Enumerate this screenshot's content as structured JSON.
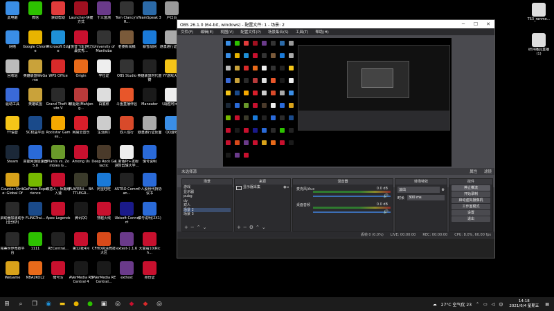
{
  "desktop_icons": [
    {
      "label": "此电脑",
      "color": "#3a8ee6"
    },
    {
      "label": "微信",
      "color": "#2dc100"
    },
    {
      "label": "获取帮助",
      "color": "#e23b3b"
    },
    {
      "label": "Launcher-快捷方式",
      "color": "#a01020"
    },
    {
      "label": "十三盒测",
      "color": "#6a3a8a"
    },
    {
      "label": "Tom Clancy's R...",
      "color": "#333"
    },
    {
      "label": "TeamSpeak 3",
      "color": "#2b6aa8"
    },
    {
      "label": "户口页",
      "color": "#999"
    },
    {
      "label": "网络",
      "color": "#3a8ee6"
    },
    {
      "label": "Google Chrome",
      "color": "#e8b400"
    },
    {
      "label": "Microsoft Edge",
      "color": "#1e90d8"
    },
    {
      "label": "[悦音飞车]努力最优秀...",
      "color": "#c8102e"
    },
    {
      "label": "University of Manitoba",
      "color": "#333"
    },
    {
      "label": "老婆新闻稿",
      "color": "#7a5a3a"
    },
    {
      "label": "暴雪战网",
      "color": "#1a7ad8"
    },
    {
      "label": "港澳通行证正面",
      "color": "#aaa"
    },
    {
      "label": "回收站",
      "color": "#bbb"
    },
    {
      "label": "英雄联盟WeGame",
      "color": "#c9a23a"
    },
    {
      "label": "WPS Office",
      "color": "#d82a2a"
    },
    {
      "label": "Origin",
      "color": "#e86a1a"
    },
    {
      "label": "学位证",
      "color": "#eee"
    },
    {
      "label": "OBS Studio",
      "color": "#333"
    },
    {
      "label": "英雄联盟时代重铸",
      "color": "#222"
    },
    {
      "label": "YY游戏大厅",
      "color": "#f5c518"
    },
    {
      "label": "驱动工具",
      "color": "#3a6ad8"
    },
    {
      "label": "英雄联盟",
      "color": "#c9a23a"
    },
    {
      "label": "Grand Theft Auto V",
      "color": "#2a2a2a"
    },
    {
      "label": "被驱逐(Mahjong...",
      "color": "#b83a3a"
    },
    {
      "label": "白底照",
      "color": "#ddd"
    },
    {
      "label": "斗鱼直播伴侣",
      "color": "#e8562a"
    },
    {
      "label": "Maneater",
      "color": "#1a1a1a"
    },
    {
      "label": "《战胜阿兵》5",
      "color": "#eee"
    },
    {
      "label": "YY语音",
      "color": "#f5c518"
    },
    {
      "label": "SC权益平台",
      "color": "#1a4a8a"
    },
    {
      "label": "Rockstar Games...",
      "color": "#f5a800"
    },
    {
      "label": "网易云音乐",
      "color": "#d81e2a"
    },
    {
      "label": "生活照1",
      "color": "#ccc"
    },
    {
      "label": "双人成行",
      "color": "#d84a2a"
    },
    {
      "label": "港澳通行证反面",
      "color": "#aaa"
    },
    {
      "label": "QQ游戏",
      "color": "#3a8ee6"
    },
    {
      "label": "Steam",
      "color": "#1b2838"
    },
    {
      "label": "高能网游加速器5.0",
      "color": "#2a6ad8"
    },
    {
      "label": "Plants vs. Zombies G...",
      "color": "#6a9a2a"
    },
    {
      "label": "Among Us",
      "color": "#c8102e"
    },
    {
      "label": "Deep Rock Galactic",
      "color": "#4a3a2a"
    },
    {
      "label": "1.新版Pr+发射进阶剪辑大学...",
      "color": "#eee"
    },
    {
      "label": "慎号说明",
      "color": "#2a6ad8"
    },
    {
      "label": "Counter-Strike: Global Off...",
      "color": "#d8a21a"
    },
    {
      "label": "GeForce Experience",
      "color": "#76b900"
    },
    {
      "label": "蝶恋人，师期增入速",
      "color": "#c8102e"
    },
    {
      "label": "PLAYERU... BATTLEGR...",
      "color": "#3a3a2a"
    },
    {
      "label": "阿里旺旺",
      "color": "#1a7ad8"
    },
    {
      "label": "ASTRO Comman...",
      "color": "#222"
    },
    {
      "label": "个人股份代持协议书",
      "color": "#2a6ad8"
    },
    {
      "label": "启动器加速助手(全分析)",
      "color": "#2a2a2a"
    },
    {
      "label": "FLiNGTrai...",
      "color": "#1a4a8a"
    },
    {
      "label": "Apex Legends",
      "color": "#c8102e"
    },
    {
      "label": "腾讯QQ",
      "color": "#1a1a1a"
    },
    {
      "label": "穿越火线",
      "color": "#c8102e"
    },
    {
      "label": "Ubisoft Connect",
      "color": "#1a1a8a"
    },
    {
      "label": "慎号说明(2X1)",
      "color": "#2a6ad8"
    },
    {
      "label": "完美世界竞技平台",
      "color": "#2a2a2a"
    },
    {
      "label": "1111",
      "color": "#2dc100"
    },
    {
      "label": "RECentral...",
      "color": "#222"
    },
    {
      "label": "第12批4月",
      "color": "#c8102e"
    },
    {
      "label": "CFHD高清竞技大区",
      "color": "#d84a1a"
    },
    {
      "label": "extest-1.1.6",
      "color": "#6a3a8a"
    },
    {
      "label": "大富翁10(Rich...",
      "color": "#c8102e"
    },
    {
      "label": "WeGame",
      "color": "#d8a21a"
    },
    {
      "label": "NBA2KOL2",
      "color": "#e86a1a"
    },
    {
      "label": "暗号写",
      "color": "#c8102e"
    },
    {
      "label": "AVerMedia RECentral 4",
      "color": "#1a1a1a"
    },
    {
      "label": "AVerMedia RECentral...",
      "color": "#1a1a1a"
    },
    {
      "label": "exttest",
      "color": "#6a3a8a"
    },
    {
      "label": "身份证",
      "color": "#c8102e"
    }
  ],
  "right_icons": [
    {
      "label": "TS3_ranmo...",
      "color": "#ddd"
    },
    {
      "label": "研评播具直播(1)",
      "color": "#ddd"
    }
  ],
  "obs": {
    "title": "OBS 26.1.0 (64-bit, windows) - 配置文件: 1 - 场景: 2",
    "menu": [
      "文件(F)",
      "编辑(E)",
      "视图(V)",
      "配置文件(P)",
      "场景集合(S)",
      "工具(T)",
      "帮助(H)"
    ],
    "preview_bar_left": "未选择源",
    "preview_bar_props": "属性",
    "preview_bar_filters": "滤镜",
    "scenes_head": "场景",
    "scenes": [
      "游戏",
      "显示器",
      "pubg",
      "dy",
      "双人",
      "场景 2",
      "场景 3"
    ],
    "sources_head": "来源",
    "sources": [
      "显示器采集"
    ],
    "mixer_head": "混音器",
    "mixer": [
      {
        "name": "麦克风/Aux",
        "db": "0.0 dB"
      },
      {
        "name": "桌面音频",
        "db": "0.0 dB"
      }
    ],
    "transitions_head": "转场特效",
    "transition_type": "淡出",
    "duration_label": "时长",
    "duration_value": "300 ms",
    "controls_head": "控件",
    "controls": [
      "停止推流",
      "开始录制",
      "启动虚拟摄像机",
      "工作室模式",
      "设置",
      "退出"
    ],
    "status": [
      "丢帧 0 (0.0%)",
      "LIVE: 00:00:00",
      "REC: 00:00:00",
      "CPU: 8.0%, 60.00 fps"
    ]
  },
  "taskbar": {
    "weather": "27°C 空气优 23",
    "time": "14:18",
    "date": "2021/6/4 星期五"
  }
}
